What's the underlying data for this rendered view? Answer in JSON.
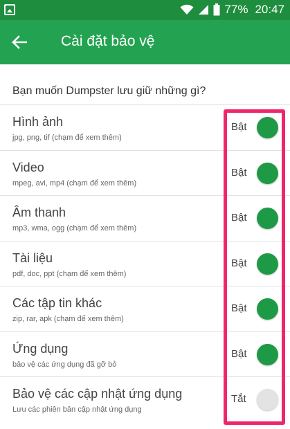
{
  "status_bar": {
    "battery": "77%",
    "time": "20:47"
  },
  "toolbar": {
    "title": "Cài đặt bảo vệ",
    "back_icon": "arrow-left-icon"
  },
  "section": {
    "header": "Bạn muốn Dumpster lưu giữ những gì?"
  },
  "items": [
    {
      "title": "Hình ảnh",
      "subtitle": "jpg, png, tif (chạm để xem thêm)",
      "state": "Bật",
      "on": true
    },
    {
      "title": "Video",
      "subtitle": "mpeg, avi, mp4 (chạm để xem thêm)",
      "state": "Bật",
      "on": true
    },
    {
      "title": "Âm thanh",
      "subtitle": "mp3, wma, ogg (chạm để xem thêm)",
      "state": "Bật",
      "on": true
    },
    {
      "title": "Tài liệu",
      "subtitle": "pdf, doc, ppt (chạm để xem thêm)",
      "state": "Bật",
      "on": true
    },
    {
      "title": "Các tập tin khác",
      "subtitle": "zip, rar, apk (chạm để xem thêm)",
      "state": "Bật",
      "on": true
    },
    {
      "title": "Ứng dụng",
      "subtitle": "bảo vệ các ứng dụng đã gỡ bỏ",
      "state": "Bật",
      "on": true
    },
    {
      "title": "Bảo vệ các cập nhật ứng dụng",
      "subtitle": "Lưu các phiên bản cập nhật ứng dụng",
      "state": "Tắt",
      "on": false
    }
  ],
  "colors": {
    "toolbar": "#23a351",
    "status_bar": "#1e8e3e",
    "switch_on": "#1e9a47",
    "switch_off": "#e3e3e3",
    "highlight": "#f0266a"
  }
}
